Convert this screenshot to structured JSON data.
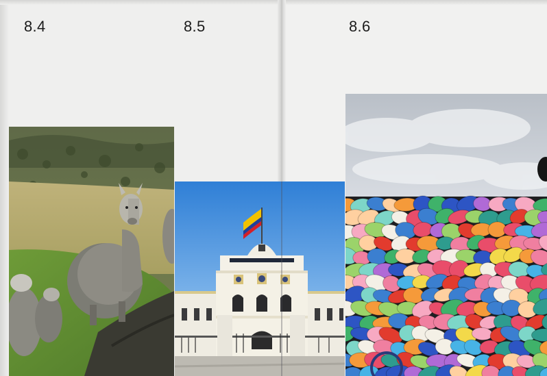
{
  "labels": {
    "fig_84": "8.4",
    "fig_85": "8.5",
    "fig_86": "8.6"
  },
  "colors": {
    "paper": "#efefee",
    "text": "#1b1b1b",
    "sky": "#5f9fe0",
    "grass": "#6f9a3a"
  },
  "flag": {
    "colors": [
      "#f2c200",
      "#1f3f9a",
      "#d41f28"
    ]
  }
}
